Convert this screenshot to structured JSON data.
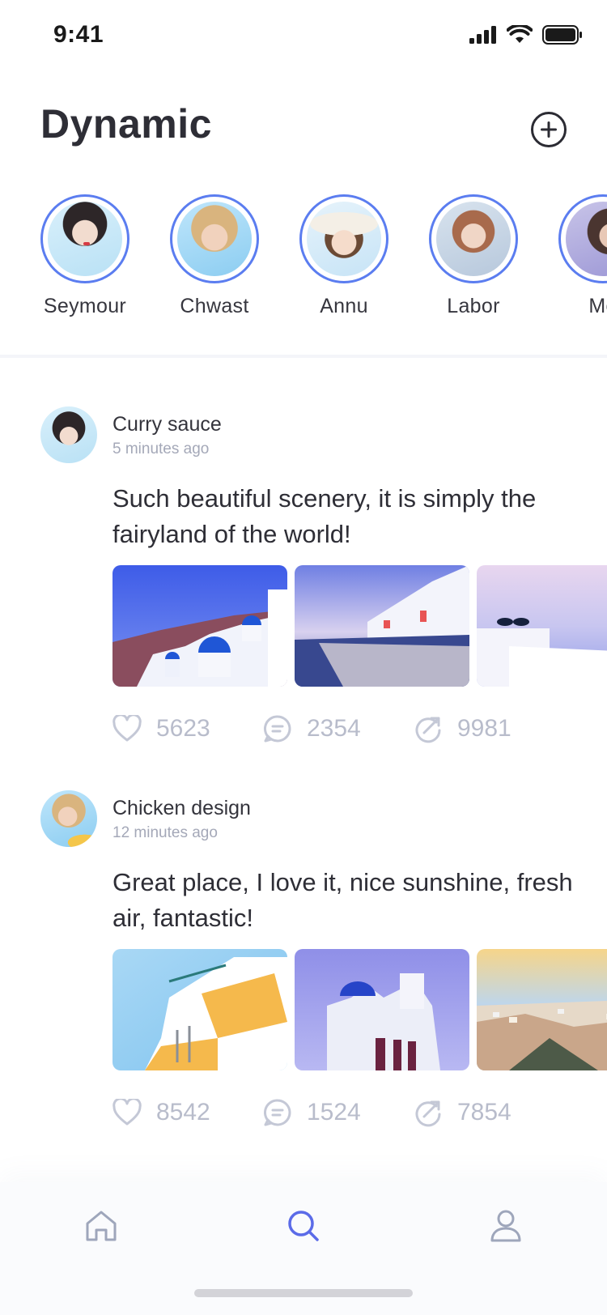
{
  "status_bar": {
    "time": "9:41"
  },
  "header": {
    "title": "Dynamic",
    "add_icon": "plus-circle-icon"
  },
  "stories": [
    {
      "name": "Seymour"
    },
    {
      "name": "Chwast"
    },
    {
      "name": "Annu"
    },
    {
      "name": "Labor"
    },
    {
      "name": "Mo"
    }
  ],
  "posts": [
    {
      "author": "Curry sauce",
      "time": "5 minutes ago",
      "text": "Such beautiful scenery, it is simply the fairyland of the world!",
      "likes": "5623",
      "comments": "2354",
      "shares": "9981"
    },
    {
      "author": "Chicken design",
      "time": "12 minutes ago",
      "text": "Great place, I love it, nice sunshine, fresh air, fantastic!",
      "likes": "8542",
      "comments": "1524",
      "shares": "7854"
    }
  ],
  "tab_bar": {
    "items": [
      {
        "icon": "home-icon",
        "active": false
      },
      {
        "icon": "search-icon",
        "active": true
      },
      {
        "icon": "profile-icon",
        "active": false
      }
    ]
  },
  "colors": {
    "accent": "#5b7df0",
    "muted": "#b8bccb",
    "text": "#2e2e36"
  }
}
